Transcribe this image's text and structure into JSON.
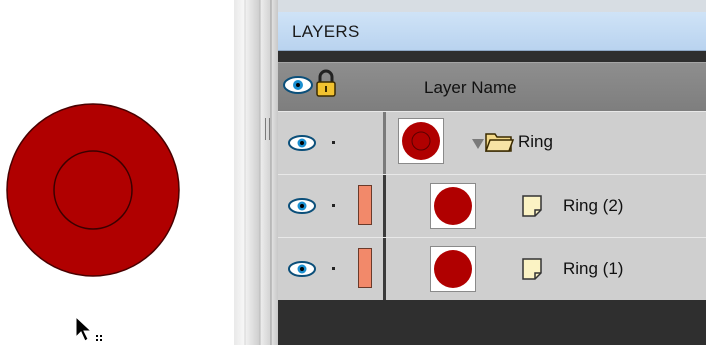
{
  "colors": {
    "shape_fill": "#b00000",
    "shape_stroke": "#4a0000",
    "tab_bg": "#c8ddf3",
    "header_bg": "#858585",
    "row_bg": "#cfcfcf",
    "layer_color_swatch": "#f2896a"
  },
  "panel": {
    "title": "LAYERS",
    "header": {
      "visibility_icon": "eye-icon",
      "lock_icon": "lock-icon",
      "column_label": "Layer Name"
    },
    "layers": [
      {
        "name": "Ring",
        "kind": "folder",
        "expanded": true,
        "icon": "folder-icon"
      },
      {
        "name": "Ring (2)",
        "kind": "layer",
        "icon": "layer-page-icon"
      },
      {
        "name": "Ring (1)",
        "kind": "layer",
        "icon": "layer-page-icon"
      }
    ]
  }
}
